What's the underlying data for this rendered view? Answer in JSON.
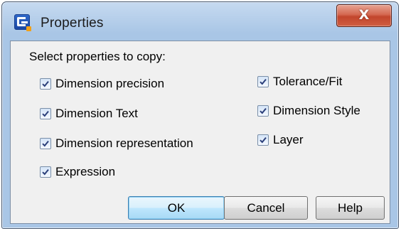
{
  "window": {
    "title": "Properties",
    "close_glyph": "X",
    "app_icon": "app-logo-icon"
  },
  "dialog": {
    "heading": "Select properties to copy:",
    "left_options": [
      {
        "label": "Dimension precision",
        "checked": true
      },
      {
        "label": "Dimension Text",
        "checked": true
      },
      {
        "label": "Dimension representation",
        "checked": true
      },
      {
        "label": "Expression",
        "checked": true
      }
    ],
    "right_options": [
      {
        "label": "Tolerance/Fit",
        "checked": true
      },
      {
        "label": "Dimension Style",
        "checked": true
      },
      {
        "label": "Layer",
        "checked": true
      }
    ],
    "buttons": {
      "ok": "OK",
      "cancel": "Cancel",
      "help": "Help"
    }
  },
  "colors": {
    "checkmark": "#2b3f7a",
    "default_button_border": "#3c7fb1"
  }
}
